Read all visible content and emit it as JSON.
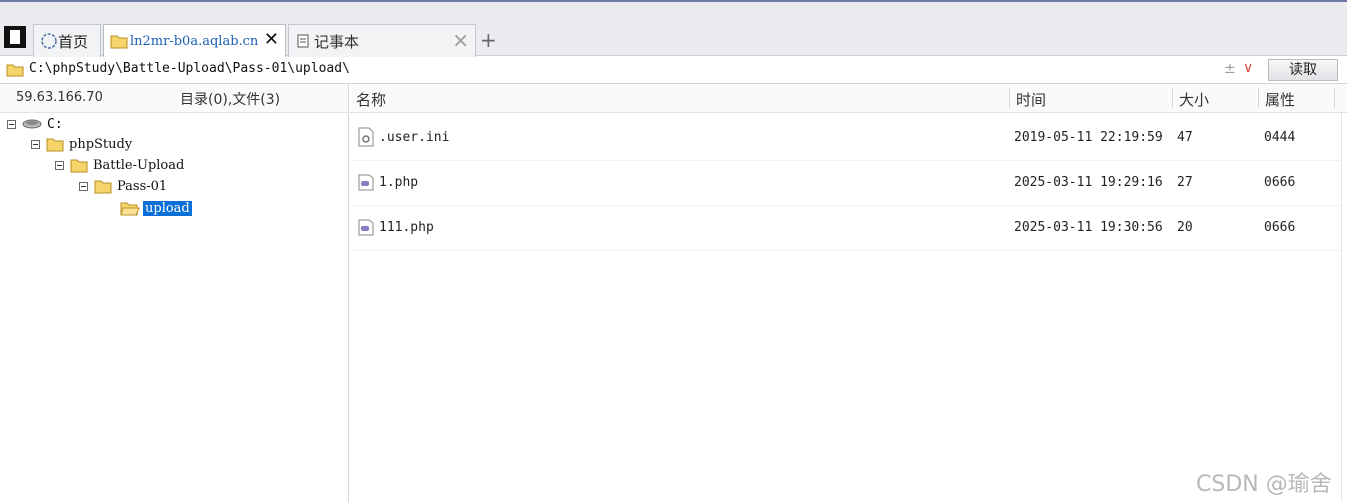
{
  "tabs": [
    {
      "label": "首页",
      "icon": "globe-icon"
    },
    {
      "label": "ln2mr-b0a.aqlab.cn",
      "icon": "folder-icon"
    },
    {
      "label": "记事本",
      "icon": "notepad-icon"
    }
  ],
  "tab_close_active": "✕",
  "tab_close_inactive": "×",
  "add_tab": "+",
  "address": {
    "path": "C:\\phpStudy\\Battle-Upload\\Pass-01\\upload\\",
    "read_button": "读取"
  },
  "left_panel": {
    "ip": "59.63.166.70",
    "summary": "目录(0),文件(3)"
  },
  "tree": [
    {
      "label": "C:",
      "icon": "drive-icon"
    },
    {
      "label": "phpStudy",
      "icon": "folder-icon"
    },
    {
      "label": "Battle-Upload",
      "icon": "folder-icon"
    },
    {
      "label": "Pass-01",
      "icon": "folder-icon"
    },
    {
      "label": "upload",
      "icon": "folder-open-icon",
      "selected": true
    }
  ],
  "columns": {
    "name": "名称",
    "time": "时间",
    "size": "大小",
    "attr": "属性"
  },
  "files": [
    {
      "name": ".user.ini",
      "time": "2019-05-11 22:19:59",
      "size": "47",
      "attr": "0444",
      "icon": "config-file-icon"
    },
    {
      "name": "1.php",
      "time": "2025-03-11 19:29:16",
      "size": "27",
      "attr": "0666",
      "icon": "php-file-icon"
    },
    {
      "name": "111.php",
      "time": "2025-03-11 19:30:56",
      "size": "20",
      "attr": "0666",
      "icon": "php-file-icon"
    }
  ],
  "watermark": "CSDN @瑜舍"
}
